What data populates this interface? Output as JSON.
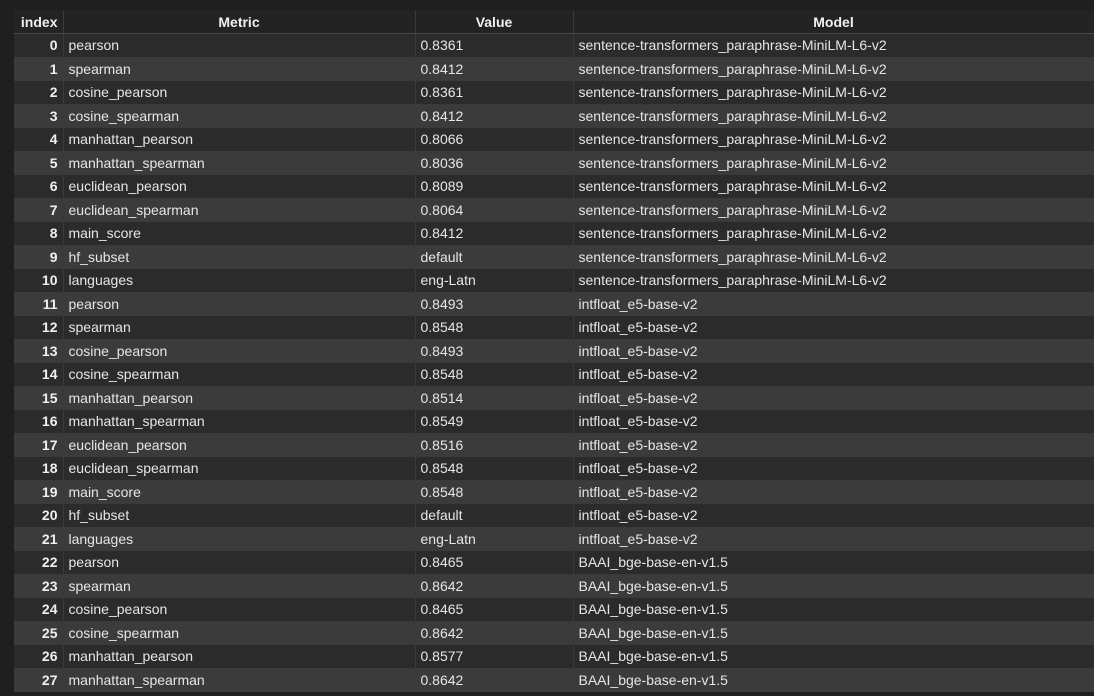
{
  "table": {
    "headers": [
      "index",
      "Metric",
      "Value",
      "Model"
    ],
    "rows": [
      [
        "0",
        "pearson",
        "0.8361",
        "sentence-transformers_paraphrase-MiniLM-L6-v2"
      ],
      [
        "1",
        "spearman",
        "0.8412",
        "sentence-transformers_paraphrase-MiniLM-L6-v2"
      ],
      [
        "2",
        "cosine_pearson",
        "0.8361",
        "sentence-transformers_paraphrase-MiniLM-L6-v2"
      ],
      [
        "3",
        "cosine_spearman",
        "0.8412",
        "sentence-transformers_paraphrase-MiniLM-L6-v2"
      ],
      [
        "4",
        "manhattan_pearson",
        "0.8066",
        "sentence-transformers_paraphrase-MiniLM-L6-v2"
      ],
      [
        "5",
        "manhattan_spearman",
        "0.8036",
        "sentence-transformers_paraphrase-MiniLM-L6-v2"
      ],
      [
        "6",
        "euclidean_pearson",
        "0.8089",
        "sentence-transformers_paraphrase-MiniLM-L6-v2"
      ],
      [
        "7",
        "euclidean_spearman",
        "0.8064",
        "sentence-transformers_paraphrase-MiniLM-L6-v2"
      ],
      [
        "8",
        "main_score",
        "0.8412",
        "sentence-transformers_paraphrase-MiniLM-L6-v2"
      ],
      [
        "9",
        "hf_subset",
        "default",
        "sentence-transformers_paraphrase-MiniLM-L6-v2"
      ],
      [
        "10",
        "languages",
        "eng-Latn",
        "sentence-transformers_paraphrase-MiniLM-L6-v2"
      ],
      [
        "11",
        "pearson",
        "0.8493",
        "intfloat_e5-base-v2"
      ],
      [
        "12",
        "spearman",
        "0.8548",
        "intfloat_e5-base-v2"
      ],
      [
        "13",
        "cosine_pearson",
        "0.8493",
        "intfloat_e5-base-v2"
      ],
      [
        "14",
        "cosine_spearman",
        "0.8548",
        "intfloat_e5-base-v2"
      ],
      [
        "15",
        "manhattan_pearson",
        "0.8514",
        "intfloat_e5-base-v2"
      ],
      [
        "16",
        "manhattan_spearman",
        "0.8549",
        "intfloat_e5-base-v2"
      ],
      [
        "17",
        "euclidean_pearson",
        "0.8516",
        "intfloat_e5-base-v2"
      ],
      [
        "18",
        "euclidean_spearman",
        "0.8548",
        "intfloat_e5-base-v2"
      ],
      [
        "19",
        "main_score",
        "0.8548",
        "intfloat_e5-base-v2"
      ],
      [
        "20",
        "hf_subset",
        "default",
        "intfloat_e5-base-v2"
      ],
      [
        "21",
        "languages",
        "eng-Latn",
        "intfloat_e5-base-v2"
      ],
      [
        "22",
        "pearson",
        "0.8465",
        "BAAI_bge-base-en-v1.5"
      ],
      [
        "23",
        "spearman",
        "0.8642",
        "BAAI_bge-base-en-v1.5"
      ],
      [
        "24",
        "cosine_pearson",
        "0.8465",
        "BAAI_bge-base-en-v1.5"
      ],
      [
        "25",
        "cosine_spearman",
        "0.8642",
        "BAAI_bge-base-en-v1.5"
      ],
      [
        "26",
        "manhattan_pearson",
        "0.8577",
        "BAAI_bge-base-en-v1.5"
      ],
      [
        "27",
        "manhattan_spearman",
        "0.8642",
        "BAAI_bge-base-en-v1.5"
      ]
    ]
  },
  "colors": {
    "background": "#1f1f1f",
    "row_dark": "#2b2b2b",
    "row_light": "#3b3b3b",
    "text": "#e6e6e6"
  }
}
